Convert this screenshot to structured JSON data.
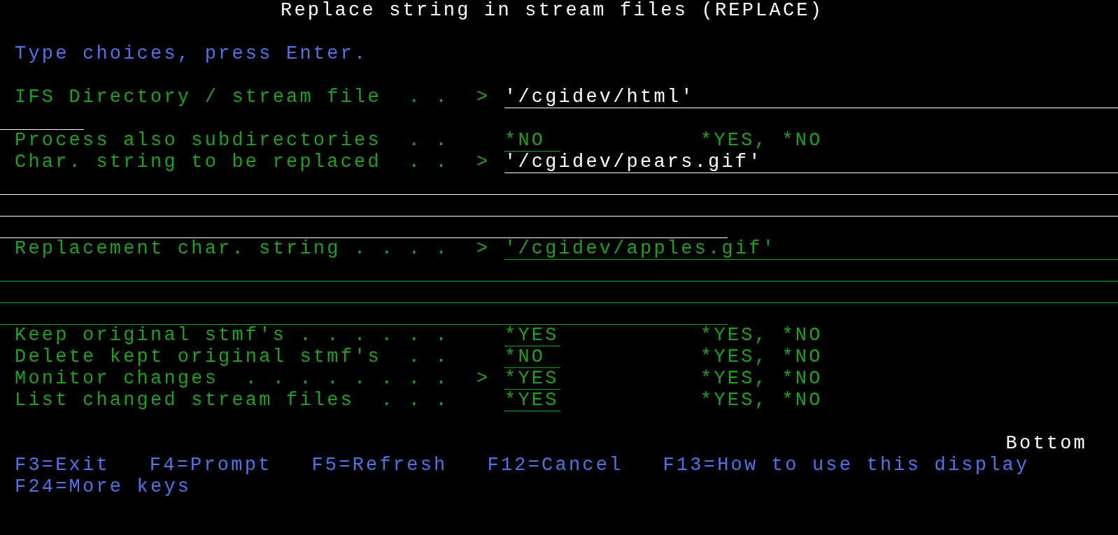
{
  "title": "Replace string in stream files (REPLACE)",
  "instruction": "Type choices, press Enter.",
  "parameters": [
    {
      "kind": "long",
      "label": "IFS Directory / stream file  . .",
      "marker": ">",
      "value": "'/cgidev/html'",
      "entered": true
    },
    {
      "kind": "short",
      "label": "Process also subdirectories  . .",
      "value": "*NO",
      "choices": "*YES, *NO",
      "entered": false
    },
    {
      "kind": "long",
      "label": "Char. string to be replaced  . .",
      "marker": ">",
      "value": "'/cgidev/pears.gif'",
      "entered": true
    },
    {
      "kind": "long",
      "label": "Replacement char. string . . . .",
      "marker": ">",
      "value": "'/cgidev/apples.gif'",
      "entered": false
    },
    {
      "kind": "short",
      "label": "Keep original stmf's . . . . . .",
      "value": "*YES",
      "choices": "*YES, *NO",
      "entered": false
    },
    {
      "kind": "short",
      "label": "Delete kept original stmf's  . .",
      "value": "*NO",
      "choices": "*YES, *NO",
      "entered": false
    },
    {
      "kind": "short",
      "label": "Monitor changes  . . . . . . . .",
      "marker": ">",
      "value": "*YES",
      "choices": "*YES, *NO",
      "entered": false
    },
    {
      "kind": "short",
      "label": "List changed stream files  . . .",
      "value": "*YES",
      "choices": "*YES, *NO",
      "entered": false
    }
  ],
  "more": "Bottom",
  "function_keys": [
    {
      "label": "F3=Exit"
    },
    {
      "label": "F4=Prompt"
    },
    {
      "label": "F5=Refresh"
    },
    {
      "label": "F12=Cancel"
    },
    {
      "label": "F13=How to use this display"
    }
  ],
  "function_keys_2": [
    {
      "label": "F24=More keys"
    }
  ]
}
